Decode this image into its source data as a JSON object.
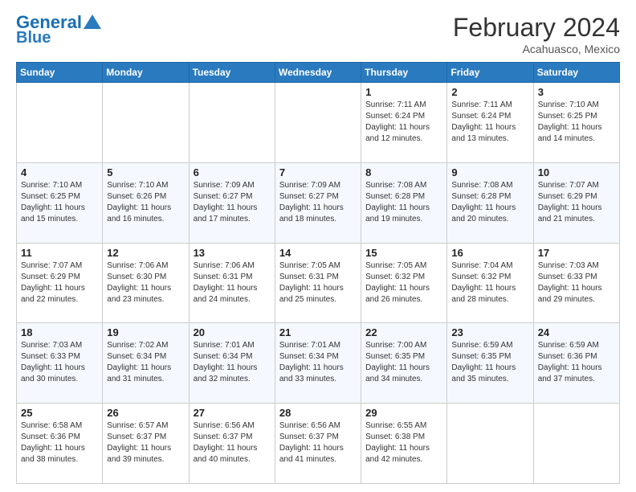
{
  "header": {
    "logo_line1": "General",
    "logo_line2": "Blue",
    "month_title": "February 2024",
    "location": "Acahuasco, Mexico"
  },
  "days_of_week": [
    "Sunday",
    "Monday",
    "Tuesday",
    "Wednesday",
    "Thursday",
    "Friday",
    "Saturday"
  ],
  "weeks": [
    [
      {
        "day": "",
        "info": ""
      },
      {
        "day": "",
        "info": ""
      },
      {
        "day": "",
        "info": ""
      },
      {
        "day": "",
        "info": ""
      },
      {
        "day": "1",
        "info": "Sunrise: 7:11 AM\nSunset: 6:24 PM\nDaylight: 11 hours\nand 12 minutes."
      },
      {
        "day": "2",
        "info": "Sunrise: 7:11 AM\nSunset: 6:24 PM\nDaylight: 11 hours\nand 13 minutes."
      },
      {
        "day": "3",
        "info": "Sunrise: 7:10 AM\nSunset: 6:25 PM\nDaylight: 11 hours\nand 14 minutes."
      }
    ],
    [
      {
        "day": "4",
        "info": "Sunrise: 7:10 AM\nSunset: 6:25 PM\nDaylight: 11 hours\nand 15 minutes."
      },
      {
        "day": "5",
        "info": "Sunrise: 7:10 AM\nSunset: 6:26 PM\nDaylight: 11 hours\nand 16 minutes."
      },
      {
        "day": "6",
        "info": "Sunrise: 7:09 AM\nSunset: 6:27 PM\nDaylight: 11 hours\nand 17 minutes."
      },
      {
        "day": "7",
        "info": "Sunrise: 7:09 AM\nSunset: 6:27 PM\nDaylight: 11 hours\nand 18 minutes."
      },
      {
        "day": "8",
        "info": "Sunrise: 7:08 AM\nSunset: 6:28 PM\nDaylight: 11 hours\nand 19 minutes."
      },
      {
        "day": "9",
        "info": "Sunrise: 7:08 AM\nSunset: 6:28 PM\nDaylight: 11 hours\nand 20 minutes."
      },
      {
        "day": "10",
        "info": "Sunrise: 7:07 AM\nSunset: 6:29 PM\nDaylight: 11 hours\nand 21 minutes."
      }
    ],
    [
      {
        "day": "11",
        "info": "Sunrise: 7:07 AM\nSunset: 6:29 PM\nDaylight: 11 hours\nand 22 minutes."
      },
      {
        "day": "12",
        "info": "Sunrise: 7:06 AM\nSunset: 6:30 PM\nDaylight: 11 hours\nand 23 minutes."
      },
      {
        "day": "13",
        "info": "Sunrise: 7:06 AM\nSunset: 6:31 PM\nDaylight: 11 hours\nand 24 minutes."
      },
      {
        "day": "14",
        "info": "Sunrise: 7:05 AM\nSunset: 6:31 PM\nDaylight: 11 hours\nand 25 minutes."
      },
      {
        "day": "15",
        "info": "Sunrise: 7:05 AM\nSunset: 6:32 PM\nDaylight: 11 hours\nand 26 minutes."
      },
      {
        "day": "16",
        "info": "Sunrise: 7:04 AM\nSunset: 6:32 PM\nDaylight: 11 hours\nand 28 minutes."
      },
      {
        "day": "17",
        "info": "Sunrise: 7:03 AM\nSunset: 6:33 PM\nDaylight: 11 hours\nand 29 minutes."
      }
    ],
    [
      {
        "day": "18",
        "info": "Sunrise: 7:03 AM\nSunset: 6:33 PM\nDaylight: 11 hours\nand 30 minutes."
      },
      {
        "day": "19",
        "info": "Sunrise: 7:02 AM\nSunset: 6:34 PM\nDaylight: 11 hours\nand 31 minutes."
      },
      {
        "day": "20",
        "info": "Sunrise: 7:01 AM\nSunset: 6:34 PM\nDaylight: 11 hours\nand 32 minutes."
      },
      {
        "day": "21",
        "info": "Sunrise: 7:01 AM\nSunset: 6:34 PM\nDaylight: 11 hours\nand 33 minutes."
      },
      {
        "day": "22",
        "info": "Sunrise: 7:00 AM\nSunset: 6:35 PM\nDaylight: 11 hours\nand 34 minutes."
      },
      {
        "day": "23",
        "info": "Sunrise: 6:59 AM\nSunset: 6:35 PM\nDaylight: 11 hours\nand 35 minutes."
      },
      {
        "day": "24",
        "info": "Sunrise: 6:59 AM\nSunset: 6:36 PM\nDaylight: 11 hours\nand 37 minutes."
      }
    ],
    [
      {
        "day": "25",
        "info": "Sunrise: 6:58 AM\nSunset: 6:36 PM\nDaylight: 11 hours\nand 38 minutes."
      },
      {
        "day": "26",
        "info": "Sunrise: 6:57 AM\nSunset: 6:37 PM\nDaylight: 11 hours\nand 39 minutes."
      },
      {
        "day": "27",
        "info": "Sunrise: 6:56 AM\nSunset: 6:37 PM\nDaylight: 11 hours\nand 40 minutes."
      },
      {
        "day": "28",
        "info": "Sunrise: 6:56 AM\nSunset: 6:37 PM\nDaylight: 11 hours\nand 41 minutes."
      },
      {
        "day": "29",
        "info": "Sunrise: 6:55 AM\nSunset: 6:38 PM\nDaylight: 11 hours\nand 42 minutes."
      },
      {
        "day": "",
        "info": ""
      },
      {
        "day": "",
        "info": ""
      }
    ]
  ]
}
